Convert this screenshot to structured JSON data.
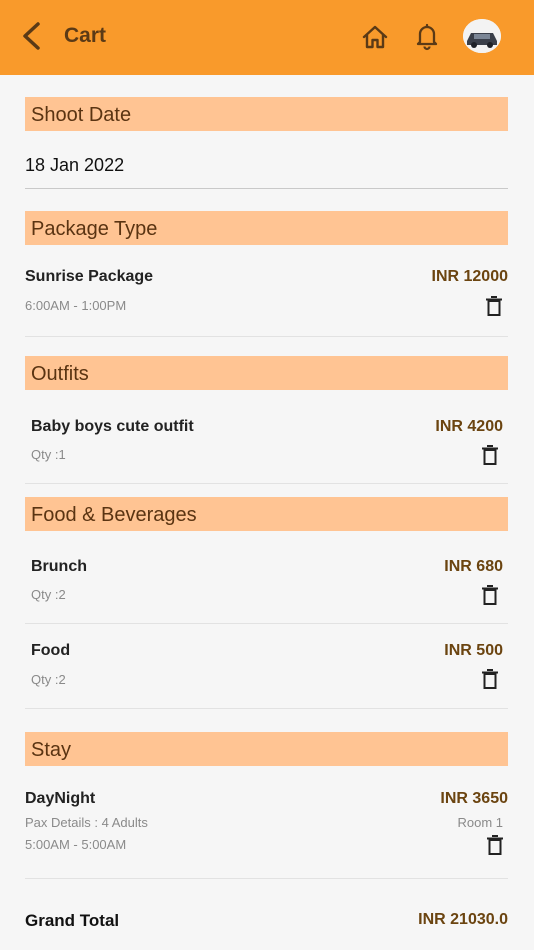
{
  "header": {
    "title": "Cart",
    "icons": [
      "back-arrow-icon",
      "home-icon",
      "bell-icon",
      "user-avatar"
    ],
    "color": "#f99a2b"
  },
  "shoot_date": {
    "heading": "Shoot Date",
    "value": "18 Jan 2022"
  },
  "package": {
    "heading": "Package Type",
    "name": "Sunrise Package",
    "price": "INR 12000",
    "time": "6:00AM - 1:00PM"
  },
  "outfits": {
    "heading": "Outfits",
    "items": [
      {
        "name": "Baby boys cute outfit",
        "price": "INR 4200",
        "qty": "Qty :1"
      }
    ]
  },
  "food": {
    "heading": "Food & Beverages",
    "items": [
      {
        "name": "Brunch",
        "price": "INR 680",
        "qty": "Qty :2"
      },
      {
        "name": "Food",
        "price": "INR 500",
        "qty": "Qty :2"
      }
    ]
  },
  "stay": {
    "heading": "Stay",
    "name": "DayNight",
    "price": "INR 3650",
    "pax": "Pax Details : 4 Adults",
    "room": "Room 1",
    "time": "5:00AM - 5:00AM"
  },
  "total": {
    "label": "Grand Total",
    "value": "INR 21030.0"
  },
  "colors": {
    "section_bg": "#ffc493",
    "price_text": "#6b4410"
  }
}
